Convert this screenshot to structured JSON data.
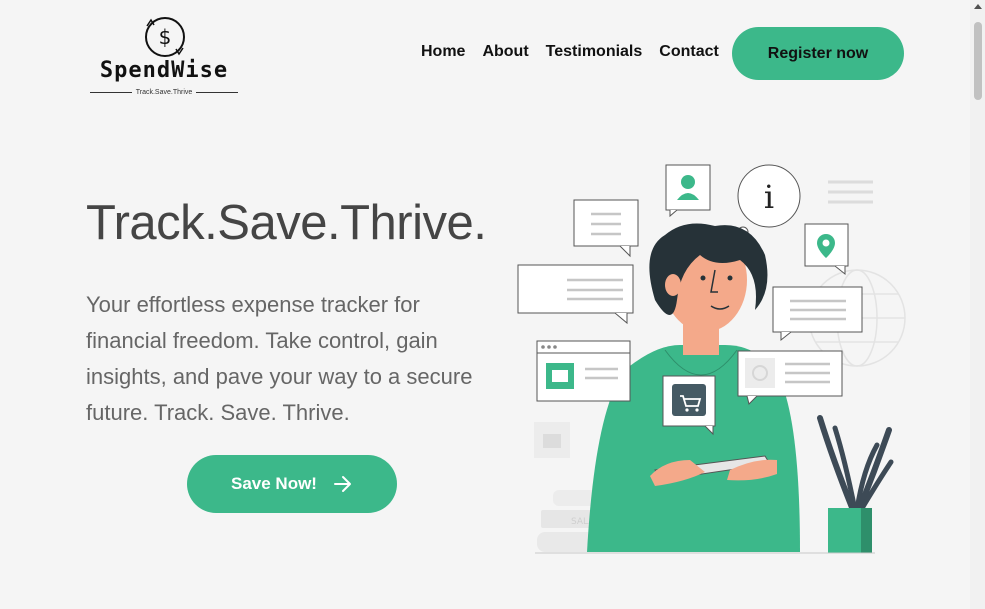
{
  "brand": {
    "name": "SpendWise",
    "tagline": "Track.Save.Thrive"
  },
  "nav": {
    "items": [
      {
        "label": "Home"
      },
      {
        "label": "About"
      },
      {
        "label": "Testimonials"
      },
      {
        "label": "Contact"
      }
    ],
    "register_label": "Register now"
  },
  "hero": {
    "title": "Track.Save.Thrive.",
    "description": "Your effortless expense tracker for financial freedom. Take control, gain insights, and pave your way to a secure future. Track. Save. Thrive.",
    "cta_label": "Save Now!",
    "cta_icon": "arrow-right-icon"
  },
  "illustration": {
    "book_label": "SALARY",
    "info_glyph": "i"
  },
  "colors": {
    "accent": "#3cb88a",
    "title": "#454545",
    "body_text": "#666666",
    "background": "#f5f5f5"
  }
}
